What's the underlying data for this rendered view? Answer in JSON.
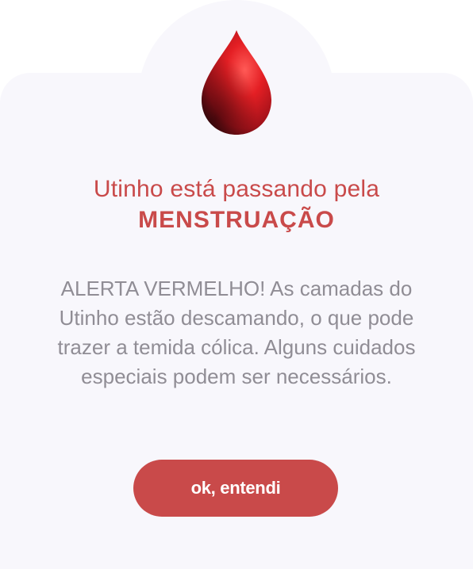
{
  "alert": {
    "icon": "blood-drop-icon",
    "title_line1": "Utinho está passando pela",
    "title_line2": "MENSTRUAÇÃO",
    "message": "ALERTA VERMELHO! As camadas do Utinho estão descamando, o que pode trazer a temida cólica. Alguns cuidados especiais podem ser necessários.",
    "button_label": "ok, entendi"
  },
  "colors": {
    "accent": "#c94a4a",
    "card_background": "#f8f7fc",
    "message_text": "#908d95",
    "button_text": "#ffffff"
  }
}
